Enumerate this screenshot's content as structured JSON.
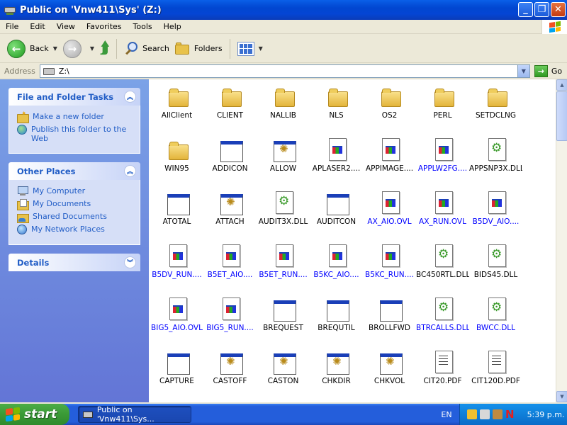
{
  "window": {
    "title": "Public on 'Vnw411\\Sys' (Z:)"
  },
  "menu": [
    "File",
    "Edit",
    "View",
    "Favorites",
    "Tools",
    "Help"
  ],
  "toolbar": {
    "back": "Back",
    "search": "Search",
    "folders": "Folders"
  },
  "address": {
    "label": "Address",
    "value": "Z:\\",
    "go": "Go"
  },
  "tasks": {
    "file_folder": {
      "title": "File and Folder Tasks",
      "items": [
        "Make a new folder",
        "Publish this folder to the Web"
      ]
    },
    "other_places": {
      "title": "Other Places",
      "items": [
        "My Computer",
        "My Documents",
        "Shared Documents",
        "My Network Places"
      ]
    },
    "details": {
      "title": "Details"
    }
  },
  "files": [
    {
      "name": "AllClient",
      "type": "folder"
    },
    {
      "name": "CLIENT",
      "type": "folder"
    },
    {
      "name": "NALLIB",
      "type": "folder"
    },
    {
      "name": "NLS",
      "type": "folder"
    },
    {
      "name": "OS2",
      "type": "folder"
    },
    {
      "name": "PERL",
      "type": "folder"
    },
    {
      "name": "SETDCLNG",
      "type": "folder"
    },
    {
      "name": "WIN95",
      "type": "folder"
    },
    {
      "name": "ADDICON",
      "type": "exe"
    },
    {
      "name": "ALLOW",
      "type": "gear"
    },
    {
      "name": "APLASER2....",
      "type": "doc"
    },
    {
      "name": "APPIMAGE....",
      "type": "doc"
    },
    {
      "name": "APPLW2FG....",
      "type": "doc",
      "blue": true
    },
    {
      "name": "APPSNP3X.DLL",
      "type": "dll"
    },
    {
      "name": "ATOTAL",
      "type": "exe"
    },
    {
      "name": "ATTACH",
      "type": "gear"
    },
    {
      "name": "AUDIT3X.DLL",
      "type": "dll"
    },
    {
      "name": "AUDITCON",
      "type": "exe"
    },
    {
      "name": "AX_AIO.OVL",
      "type": "doc",
      "blue": true
    },
    {
      "name": "AX_RUN.OVL",
      "type": "doc",
      "blue": true
    },
    {
      "name": "B5DV_AIO....",
      "type": "doc",
      "blue": true
    },
    {
      "name": "B5DV_RUN....",
      "type": "doc",
      "blue": true
    },
    {
      "name": "B5ET_AIO....",
      "type": "doc",
      "blue": true
    },
    {
      "name": "B5ET_RUN....",
      "type": "doc",
      "blue": true
    },
    {
      "name": "B5KC_AIO....",
      "type": "doc",
      "blue": true
    },
    {
      "name": "B5KC_RUN....",
      "type": "doc",
      "blue": true
    },
    {
      "name": "BC450RTL.DLL",
      "type": "dll"
    },
    {
      "name": "BIDS45.DLL",
      "type": "dll"
    },
    {
      "name": "BIG5_AIO.OVL",
      "type": "doc",
      "blue": true
    },
    {
      "name": "BIG5_RUN....",
      "type": "doc",
      "blue": true
    },
    {
      "name": "BREQUEST",
      "type": "exe"
    },
    {
      "name": "BREQUTIL",
      "type": "exe"
    },
    {
      "name": "BROLLFWD",
      "type": "exe"
    },
    {
      "name": "BTRCALLS.DLL",
      "type": "dll",
      "blue": true
    },
    {
      "name": "BWCC.DLL",
      "type": "dll",
      "blue": true
    },
    {
      "name": "CAPTURE",
      "type": "exe"
    },
    {
      "name": "CASTOFF",
      "type": "gear"
    },
    {
      "name": "CASTON",
      "type": "gear"
    },
    {
      "name": "CHKDIR",
      "type": "gear"
    },
    {
      "name": "CHKVOL",
      "type": "gear"
    },
    {
      "name": "CIT20.PDF",
      "type": "text"
    },
    {
      "name": "CIT120D.PDF",
      "type": "text"
    }
  ],
  "taskbar": {
    "start": "start",
    "window_button": "Public on 'Vnw411\\Sys...",
    "lang": "EN",
    "clock": "5:39 p.m."
  }
}
